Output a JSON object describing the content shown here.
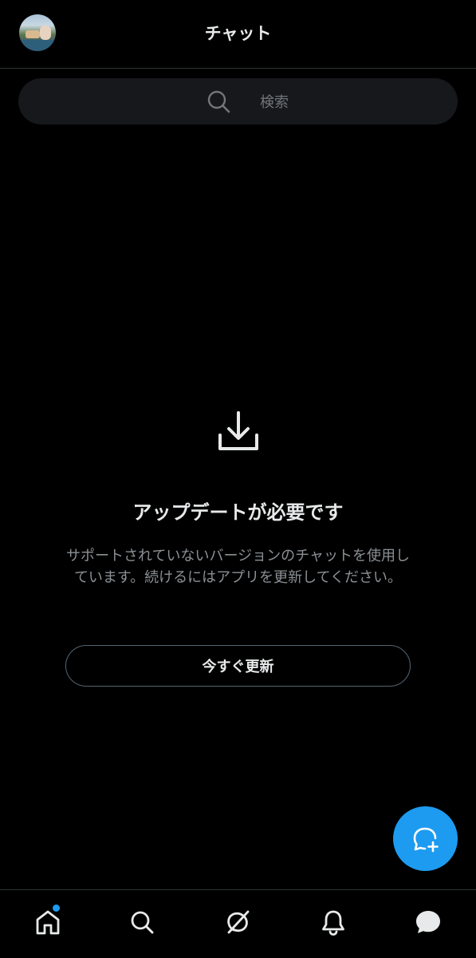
{
  "header": {
    "title": "チャット",
    "avatar_icon": "user-avatar"
  },
  "search": {
    "icon": "search-icon",
    "placeholder": "検索"
  },
  "empty_state": {
    "icon": "download-icon",
    "title": "アップデートが必要です",
    "description": "サポートされていないバージョンのチャットを使用しています。続けるにはアプリを更新してください。",
    "button_label": "今すぐ更新"
  },
  "fab": {
    "icon": "new-message-icon",
    "color": "#1d9bf0"
  },
  "bottom_nav": {
    "items": [
      {
        "name": "home",
        "icon": "home-icon",
        "has_notification_dot": true
      },
      {
        "name": "search",
        "icon": "search-icon"
      },
      {
        "name": "grok",
        "icon": "grok-icon"
      },
      {
        "name": "notifications",
        "icon": "bell-icon"
      },
      {
        "name": "messages",
        "icon": "message-icon",
        "active": true
      }
    ]
  },
  "colors": {
    "background": "#000000",
    "accent": "#1d9bf0",
    "text_primary": "#e7e9ea",
    "text_secondary": "#8b9095"
  }
}
